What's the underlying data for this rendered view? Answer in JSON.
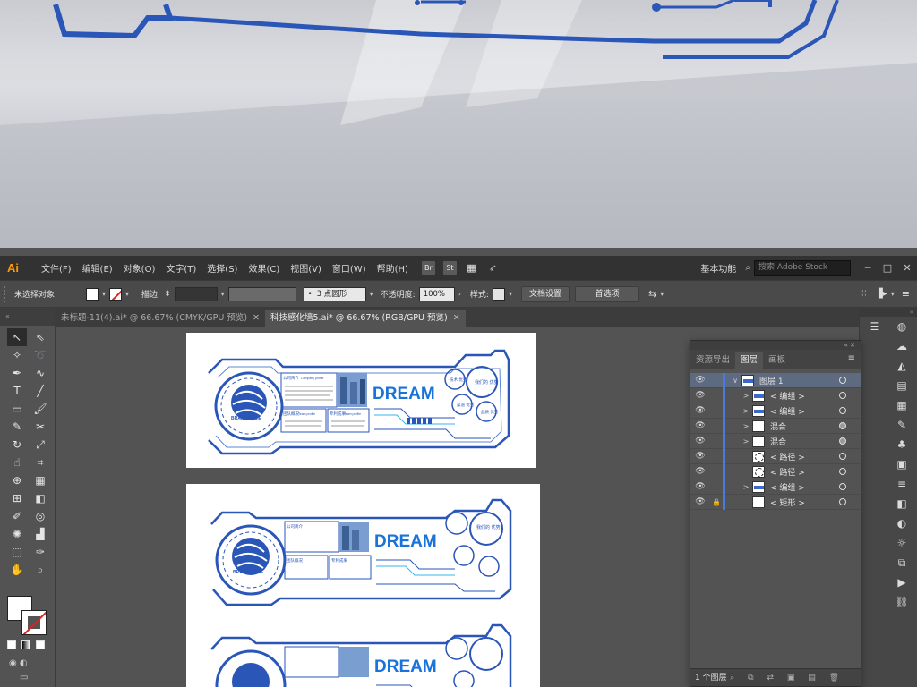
{
  "app": {
    "logo": "Ai"
  },
  "menubar": {
    "items": [
      "文件(F)",
      "编辑(E)",
      "对象(O)",
      "文字(T)",
      "选择(S)",
      "效果(C)",
      "视图(V)",
      "窗口(W)",
      "帮助(H)"
    ],
    "br_badge": "Br",
    "st_badge": "St",
    "workspace": "基本功能",
    "search_placeholder": "搜索 Adobe Stock",
    "window_controls": [
      "─",
      "□",
      "✕"
    ]
  },
  "controlbar": {
    "selection": "未选择对象",
    "stroke_label": "描边:",
    "brush_value": "3 点圆形",
    "opacity_label": "不透明度:",
    "opacity_value": "100%",
    "style_label": "样式:",
    "doc_setup": "文档设置",
    "preferences": "首选项"
  },
  "tabs": [
    {
      "label": "未标题-11(4).ai* @ 66.67% (CMYK/GPU 预览)",
      "active": false
    },
    {
      "label": "科技感化墙5.ai* @ 66.67% (RGB/GPU 预览)",
      "active": true
    }
  ],
  "artboard": {
    "company_intro": "公司简介",
    "company_profile": "Company profile",
    "brand_name": "BRAND NAME",
    "team_intro": "团队概况",
    "team_profile": "Team profile",
    "patent": "专利成果",
    "patent_profile": "Team profile",
    "dream": "DREAM",
    "tech_advantage": "技术\n优势",
    "our_advantage": "我们的\n优势",
    "channel_advantage": "渠道\n优势",
    "product_advantage": "品质\n优势"
  },
  "layers_panel": {
    "tabs": [
      "资源导出",
      "图层",
      "画板"
    ],
    "active_tab": "图层",
    "rows": [
      {
        "name": "图层 1",
        "level": 0,
        "thumb": "blue",
        "twirl": "∨",
        "lock": false,
        "target_filled": false
      },
      {
        "name": "< 编组 >",
        "level": 1,
        "thumb": "blue",
        "twirl": ">",
        "lock": false,
        "target_filled": false
      },
      {
        "name": "< 编组 >",
        "level": 1,
        "thumb": "blue",
        "twirl": ">",
        "lock": false,
        "target_filled": false
      },
      {
        "name": "混合",
        "level": 1,
        "thumb": "white",
        "twirl": ">",
        "lock": false,
        "target_filled": true
      },
      {
        "name": "混合",
        "level": 1,
        "thumb": "white",
        "twirl": ">",
        "lock": false,
        "target_filled": true
      },
      {
        "name": "< 路径 >",
        "level": 1,
        "thumb": "circle",
        "twirl": "",
        "lock": false,
        "target_filled": false
      },
      {
        "name": "< 路径 >",
        "level": 1,
        "thumb": "circle",
        "twirl": "",
        "lock": false,
        "target_filled": false
      },
      {
        "name": "< 编组 >",
        "level": 1,
        "thumb": "blue",
        "twirl": ">",
        "lock": false,
        "target_filled": false
      },
      {
        "name": "< 矩形 >",
        "level": 1,
        "thumb": "white",
        "twirl": "",
        "lock": true,
        "target_filled": false
      }
    ],
    "footer": "1 个图层"
  },
  "colors": {
    "accent_blue": "#2a56b8",
    "dream_blue": "#1a73d9",
    "light_blue": "#34b6e8"
  }
}
